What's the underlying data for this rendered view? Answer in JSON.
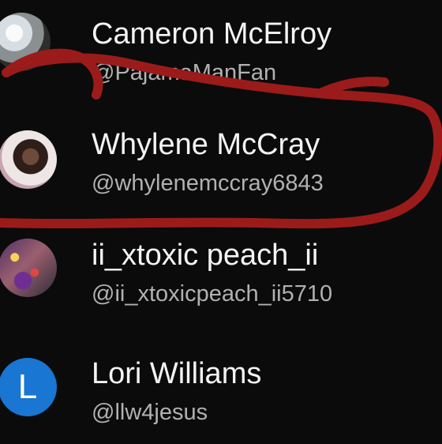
{
  "users": [
    {
      "name": "Cameron McElroy",
      "handle": "@PajamaManFan",
      "avatar": "photo"
    },
    {
      "name": "Whylene McCray",
      "handle": "@whylenemccray6843",
      "avatar": "photo"
    },
    {
      "name": "ii_xtoxic peach_ii",
      "handle": "@ii_xtoxicpeach_ii5710",
      "avatar": "photo"
    },
    {
      "name": "Lori Williams",
      "handle": "@llw4jesus",
      "avatar_letter": "L"
    }
  ],
  "annotation": {
    "color": "#9b1b1b"
  }
}
